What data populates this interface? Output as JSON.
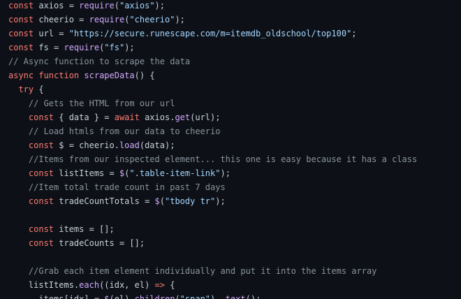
{
  "editor": {
    "language": "javascript",
    "colors": {
      "background": "#0d1117",
      "text": "#c9d1d9",
      "keyword": "#ff7b72",
      "function": "#d2a8ff",
      "string": "#a5d6ff",
      "comment": "#8b949e"
    },
    "lines": [
      [
        [
          "kw",
          "const"
        ],
        [
          "id",
          " axios = "
        ],
        [
          "fn",
          "require"
        ],
        [
          "id",
          "("
        ],
        [
          "str",
          "\"axios\""
        ],
        [
          "id",
          ");"
        ]
      ],
      [
        [
          "kw",
          "const"
        ],
        [
          "id",
          " cheerio = "
        ],
        [
          "fn",
          "require"
        ],
        [
          "id",
          "("
        ],
        [
          "str",
          "\"cheerio\""
        ],
        [
          "id",
          ");"
        ]
      ],
      [
        [
          "kw",
          "const"
        ],
        [
          "id",
          " url = "
        ],
        [
          "str",
          "\"https://secure.runescape.com/m=itemdb_oldschool/top100\""
        ],
        [
          "id",
          ";"
        ]
      ],
      [
        [
          "kw",
          "const"
        ],
        [
          "id",
          " fs = "
        ],
        [
          "fn",
          "require"
        ],
        [
          "id",
          "("
        ],
        [
          "str",
          "\"fs\""
        ],
        [
          "id",
          ");"
        ]
      ],
      [
        [
          "cm",
          "// Async function to scrape the data"
        ]
      ],
      [
        [
          "kw",
          "async"
        ],
        [
          "id",
          " "
        ],
        [
          "kw",
          "function"
        ],
        [
          "id",
          " "
        ],
        [
          "fn",
          "scrapeData"
        ],
        [
          "id",
          "() {"
        ]
      ],
      [
        [
          "id",
          "  "
        ],
        [
          "kw",
          "try"
        ],
        [
          "id",
          " {"
        ]
      ],
      [
        [
          "id",
          "    "
        ],
        [
          "cm",
          "// Gets the HTML from our url"
        ]
      ],
      [
        [
          "id",
          "    "
        ],
        [
          "kw",
          "const"
        ],
        [
          "id",
          " { data } = "
        ],
        [
          "kw",
          "await"
        ],
        [
          "id",
          " axios."
        ],
        [
          "fn",
          "get"
        ],
        [
          "id",
          "(url);"
        ]
      ],
      [
        [
          "id",
          "    "
        ],
        [
          "cm",
          "// Load htmls from our data to cheerio"
        ]
      ],
      [
        [
          "id",
          "    "
        ],
        [
          "kw",
          "const"
        ],
        [
          "id",
          " $ = cheerio."
        ],
        [
          "fn",
          "load"
        ],
        [
          "id",
          "(data);"
        ]
      ],
      [
        [
          "id",
          "    "
        ],
        [
          "cm",
          "//Items from our inspected element... this one is easy because it has a class"
        ]
      ],
      [
        [
          "id",
          "    "
        ],
        [
          "kw",
          "const"
        ],
        [
          "id",
          " listItems = "
        ],
        [
          "fn",
          "$"
        ],
        [
          "id",
          "("
        ],
        [
          "str",
          "\".table-item-link\""
        ],
        [
          "id",
          ");"
        ]
      ],
      [
        [
          "id",
          "    "
        ],
        [
          "cm",
          "//Item total trade count in past 7 days"
        ]
      ],
      [
        [
          "id",
          "    "
        ],
        [
          "kw",
          "const"
        ],
        [
          "id",
          " tradeCountTotals = "
        ],
        [
          "fn",
          "$"
        ],
        [
          "id",
          "("
        ],
        [
          "str",
          "\"tbody tr\""
        ],
        [
          "id",
          ");"
        ]
      ],
      [
        [
          "id",
          ""
        ]
      ],
      [
        [
          "id",
          "    "
        ],
        [
          "kw",
          "const"
        ],
        [
          "id",
          " items = [];"
        ]
      ],
      [
        [
          "id",
          "    "
        ],
        [
          "kw",
          "const"
        ],
        [
          "id",
          " tradeCounts = [];"
        ]
      ],
      [
        [
          "id",
          ""
        ]
      ],
      [
        [
          "id",
          "    "
        ],
        [
          "cm",
          "//Grab each item element individually and put it into the items array"
        ]
      ],
      [
        [
          "id",
          "    listItems."
        ],
        [
          "fn",
          "each"
        ],
        [
          "id",
          "((idx, el) "
        ],
        [
          "kw",
          "=>"
        ],
        [
          "id",
          " {"
        ]
      ],
      [
        [
          "id",
          "      items[idx] = "
        ],
        [
          "fn",
          "$"
        ],
        [
          "id",
          "(el)."
        ],
        [
          "fn",
          "children"
        ],
        [
          "id",
          "("
        ],
        [
          "str",
          "\"span\""
        ],
        [
          "id",
          "). "
        ],
        [
          "fn",
          "text"
        ],
        [
          "id",
          "();"
        ]
      ]
    ]
  }
}
